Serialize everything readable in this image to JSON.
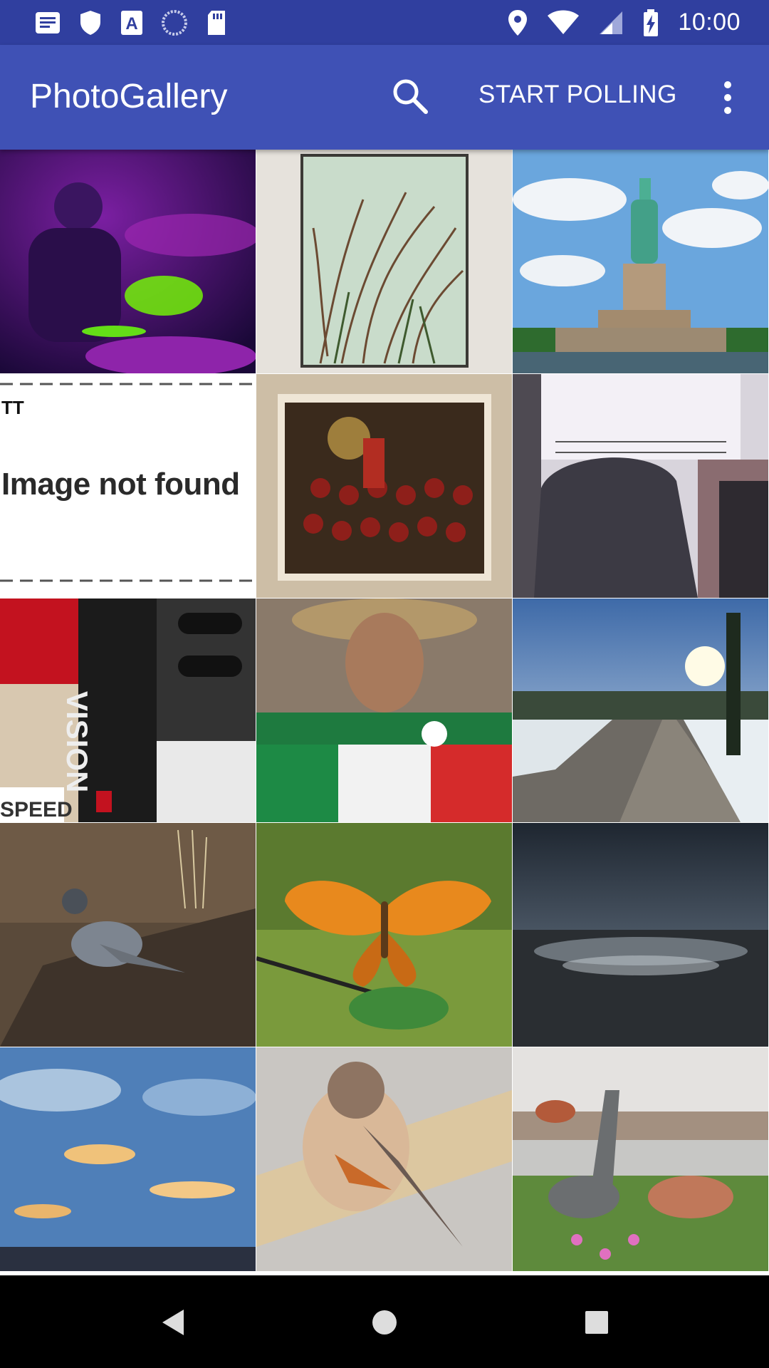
{
  "status_bar": {
    "time": "10:00",
    "left_icons": [
      "notification-message-icon",
      "shield-icon",
      "font-a-icon",
      "sync-circle-icon",
      "sd-card-icon"
    ],
    "right_icons": [
      "location-icon",
      "wifi-icon",
      "signal-icon",
      "battery-charging-icon"
    ]
  },
  "app_bar": {
    "title": "PhotoGallery",
    "search_icon": "search-icon",
    "polling_label": "START POLLING",
    "overflow_icon": "more-vert-icon"
  },
  "grid": {
    "columns": 3,
    "tiles": [
      {
        "name": "photo-drummer",
        "subject": "drummer"
      },
      {
        "name": "photo-grass-frame",
        "subject": "grass"
      },
      {
        "name": "photo-statue-of-liberty",
        "subject": "statue"
      },
      {
        "name": "photo-image-not-found",
        "subject": "notfound",
        "text_top": "TT",
        "text": "Image not found"
      },
      {
        "name": "photo-painting",
        "subject": "painting"
      },
      {
        "name": "photo-covered-car",
        "subject": "car"
      },
      {
        "name": "photo-vision-machine",
        "subject": "vision",
        "text": "VISION",
        "text_bottom": "SPEED"
      },
      {
        "name": "photo-man-with-flag",
        "subject": "man"
      },
      {
        "name": "photo-snowy-road",
        "subject": "road"
      },
      {
        "name": "photo-falcon",
        "subject": "falcon"
      },
      {
        "name": "photo-butterfly",
        "subject": "butterfly"
      },
      {
        "name": "photo-sea-sunset",
        "subject": "sea"
      },
      {
        "name": "photo-cloudy-sky",
        "subject": "sky"
      },
      {
        "name": "photo-small-bird",
        "subject": "bird"
      },
      {
        "name": "photo-dinosaur-garden",
        "subject": "dino"
      }
    ]
  },
  "nav_bar": {
    "back_icon": "back-triangle-icon",
    "home_icon": "home-circle-icon",
    "recents_icon": "recents-square-icon"
  }
}
